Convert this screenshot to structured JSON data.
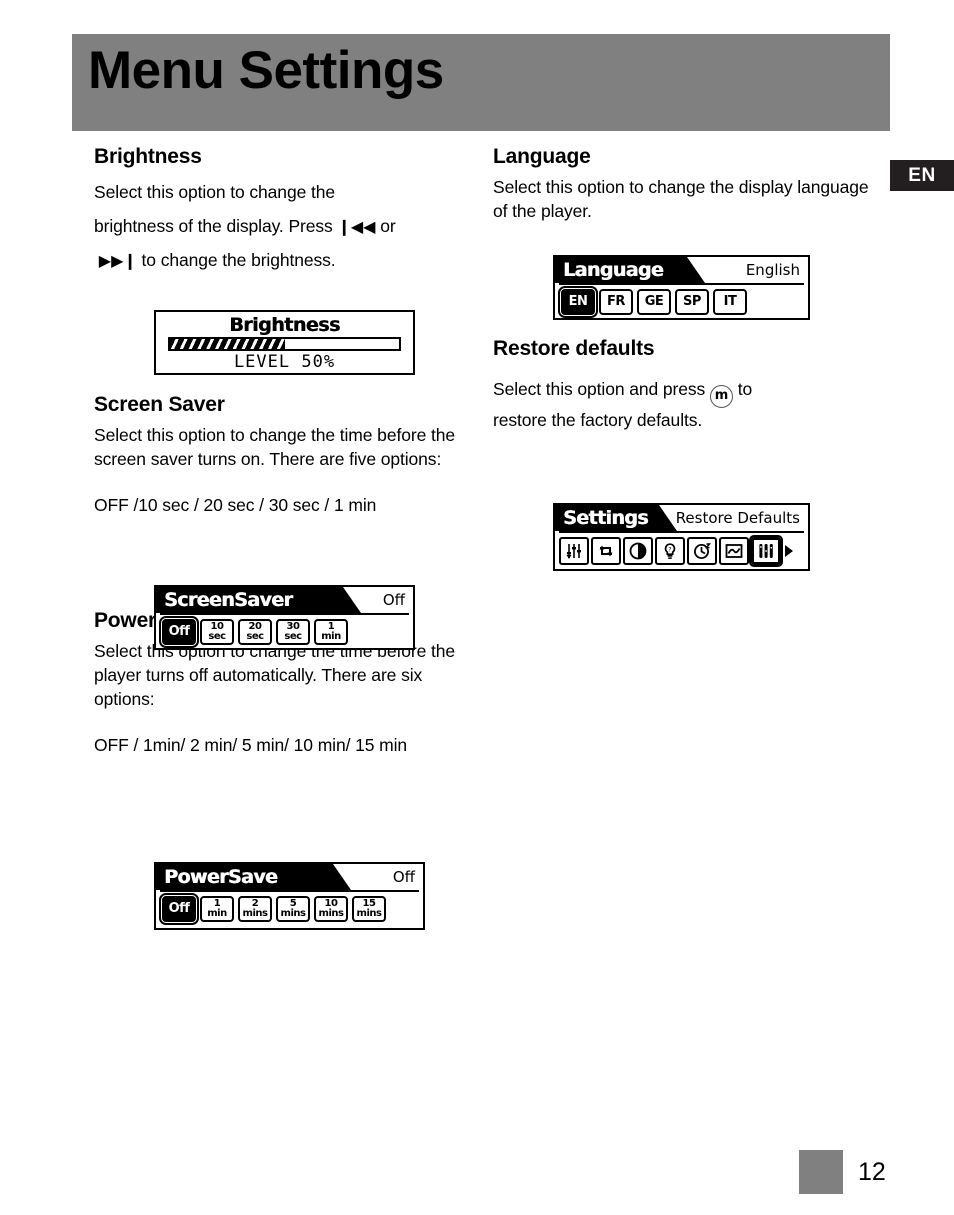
{
  "page": {
    "header_title": "Menu Settings",
    "language_badge": "EN",
    "page_number": "12"
  },
  "left_column": {
    "brightness": {
      "title": "Brightness",
      "text_line1": "Select this option to change the",
      "text_line2_a": "brightness of the display. Press",
      "prev_icon": "❙◀◀",
      "text_line2_b": "or",
      "next_icon": "▶▶❙",
      "text_line3": "to change the brightness.",
      "lcd": {
        "title": "Brightness",
        "level_label": "LEVEL 50%",
        "progress_percent": 50
      }
    },
    "screen_saver": {
      "title": "Screen Saver",
      "text": "Select this option to change the time before the screen saver turns on. There are five options:",
      "options_line": "OFF /10 sec / 20 sec / 30 sec / 1 min",
      "lcd": {
        "title": "ScreenSaver",
        "value": "Off",
        "options": [
          {
            "line1": "Off",
            "line2": "",
            "selected": true
          },
          {
            "line1": "10",
            "line2": "sec",
            "selected": false
          },
          {
            "line1": "20",
            "line2": "sec",
            "selected": false
          },
          {
            "line1": "30",
            "line2": "sec",
            "selected": false
          },
          {
            "line1": "1",
            "line2": "min",
            "selected": false
          }
        ]
      }
    },
    "power_save": {
      "title": "Power Save",
      "text": "Select this option to change the time before the player turns off automatically. There are six options:",
      "options_line": "OFF / 1min/ 2 min/ 5 min/ 10 min/ 15 min",
      "lcd": {
        "title": "PowerSave",
        "value": "Off",
        "options": [
          {
            "line1": "Off",
            "line2": "",
            "selected": true
          },
          {
            "line1": "1",
            "line2": "min",
            "selected": false
          },
          {
            "line1": "2",
            "line2": "mins",
            "selected": false
          },
          {
            "line1": "5",
            "line2": "mins",
            "selected": false
          },
          {
            "line1": "10",
            "line2": "mins",
            "selected": false
          },
          {
            "line1": "15",
            "line2": "mins",
            "selected": false
          }
        ]
      }
    }
  },
  "right_column": {
    "language": {
      "title": "Language",
      "text": "Select this option to change the display language of the player.",
      "lcd": {
        "title": "Language",
        "value": "English",
        "options": [
          {
            "line1": "EN",
            "line2": "",
            "selected": true
          },
          {
            "line1": "FR",
            "line2": "",
            "selected": false
          },
          {
            "line1": "GE",
            "line2": "",
            "selected": false
          },
          {
            "line1": "SP",
            "line2": "",
            "selected": false
          },
          {
            "line1": "IT",
            "line2": "",
            "selected": false
          }
        ]
      }
    },
    "restore_defaults": {
      "title": "Restore defaults",
      "text_a": "Select this option and press",
      "menu_button_glyph": "m",
      "text_b": "to",
      "text_line2": "restore the factory defaults.",
      "lcd": {
        "title": "Settings",
        "value": "Restore Defaults",
        "icons": [
          {
            "name": "equalizer-icon",
            "selected": false
          },
          {
            "name": "repeat-icon",
            "selected": false
          },
          {
            "name": "contrast-icon",
            "selected": false
          },
          {
            "name": "backlight-bulb-icon",
            "selected": false
          },
          {
            "name": "sleep-timer-icon",
            "selected": false
          },
          {
            "name": "screen-saver-icon",
            "selected": false
          },
          {
            "name": "restore-defaults-icon",
            "selected": true
          }
        ],
        "has_more_arrow": true
      }
    }
  },
  "colors": {
    "header_band": "#808080",
    "badge_background": "#231f20",
    "footer_block": "#808080"
  }
}
